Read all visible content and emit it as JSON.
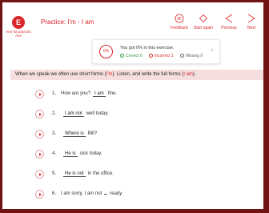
{
  "header": {
    "logo_letter": "E",
    "back_label": "Ano ha para Do Ace",
    "title": "Practice: I'm - I am",
    "tools": [
      {
        "label": "Feedback",
        "icon": "feedback-icon"
      },
      {
        "label": "Start again",
        "icon": "restart-icon"
      },
      {
        "label": "Previous",
        "icon": "previous-icon"
      },
      {
        "label": "Next",
        "icon": "next-icon"
      }
    ]
  },
  "result": {
    "score": "0%",
    "message": "You got 0% in this exercise.",
    "correct": "Correct 0",
    "incorrect": "Incorrect 1",
    "missing": "Missing 9",
    "close": "×"
  },
  "instruction": {
    "before": "When we speak we often use short forms (",
    "hl1": "I'm",
    "middle": "). Listen, and write the full forms (",
    "hl2": "I am",
    "after": ")."
  },
  "questions": [
    {
      "num": "1.",
      "before": "How are you?",
      "answer": "I am",
      "after": "fine."
    },
    {
      "num": "2.",
      "before": "",
      "answer": "I am not",
      "after": "well today."
    },
    {
      "num": "3.",
      "before": "",
      "answer": "Where is",
      "after": "Bill?"
    },
    {
      "num": "4.",
      "before": "",
      "answer": "He is",
      "after": "sick today."
    },
    {
      "num": "5.",
      "before": "",
      "answer": "He is not",
      "after": "in the office."
    },
    {
      "num": "6.",
      "before": "I am sorry. I am not",
      "answer": "",
      "after": "ready."
    }
  ]
}
